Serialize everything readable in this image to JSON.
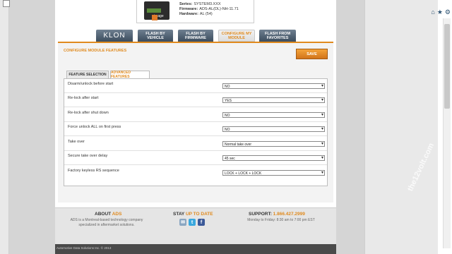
{
  "window": {
    "home_icon": "home-icon",
    "star_icon": "star-icon",
    "settings_icon": "gear-icon"
  },
  "product": {
    "series_label": "Series:",
    "series_value": "SYSTEM3.XXX",
    "firmware_label": "Firmware:",
    "firmware_value": "ADS-AL(DL)-NH-11.71",
    "hardware_label": "Hardware:",
    "hardware_value": "AL (54)",
    "badge": "image"
  },
  "nav": {
    "tabs": [
      {
        "label": "KLON"
      },
      {
        "label": "FLASH BY VEHICLE"
      },
      {
        "label": "FLASH BY FIRMWARE"
      },
      {
        "label": "CONFIGURE MY MODULE"
      },
      {
        "label": "FLASH FROM FAVORITES"
      }
    ]
  },
  "configure": {
    "title": "CONFIGURE MODULE FEATURES",
    "save_label": "SAVE",
    "subtabs": [
      {
        "label": "FEATURE SELECTION"
      },
      {
        "label": "ADVANCED FEATURES"
      }
    ],
    "features": [
      {
        "label": "Disarm/unlock before start",
        "value": "NO"
      },
      {
        "label": "Re-lock after start",
        "value": "YES"
      },
      {
        "label": "Re-lock after shut down",
        "value": "NO"
      },
      {
        "label": "Force unlock ALL on first press",
        "value": "NO"
      },
      {
        "label": "Take over",
        "value": "Normal take over"
      },
      {
        "label": "Secure take over delay",
        "value": "45 sec"
      },
      {
        "label": "Factory keyless RS sequence",
        "value": "LOCK + LOCK + LOCK"
      }
    ]
  },
  "footer": {
    "about_title_a": "ABOUT ",
    "about_title_b": "ADS",
    "about_text_1": "ADS is a Montreal-based technology company",
    "about_text_2": "specialized in aftermarket solutions.",
    "stay_title_a": "STAY ",
    "stay_title_b": "UP TO DATE",
    "support_title_a": "SUPPORT: ",
    "support_title_b": "1.866.427.2999",
    "support_text": "Monday to Friday: 8:30 am to 7:00 pm EST",
    "copyright": "Automotive Data Solutions Inc. © 2013"
  },
  "watermark": "the12volt.com",
  "colors": {
    "accent": "#e08a1e",
    "background": "#1b3550"
  }
}
